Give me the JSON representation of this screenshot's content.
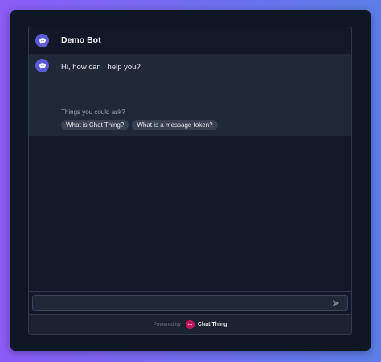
{
  "header": {
    "bot_name": "Demo Bot",
    "avatar_icon": "chat-bubble-icon"
  },
  "conversation": {
    "messages": [
      {
        "sender": "bot",
        "text": "Hi, how can I help you?"
      }
    ],
    "suggestions_label": "Things you could ask?",
    "suggestions": [
      "What is Chat Thing?",
      "What is a message token?"
    ]
  },
  "input": {
    "value": "",
    "placeholder": "",
    "send_icon": "send-icon"
  },
  "footer": {
    "powered_by": "Powered by",
    "brand": "Chat Thing",
    "brand_icon": "chat-thing-logo-icon"
  },
  "colors": {
    "avatar": "#5b5bd6",
    "brand": "#c2185b",
    "panel_bg": "#111827",
    "message_bg": "#1f2937"
  }
}
